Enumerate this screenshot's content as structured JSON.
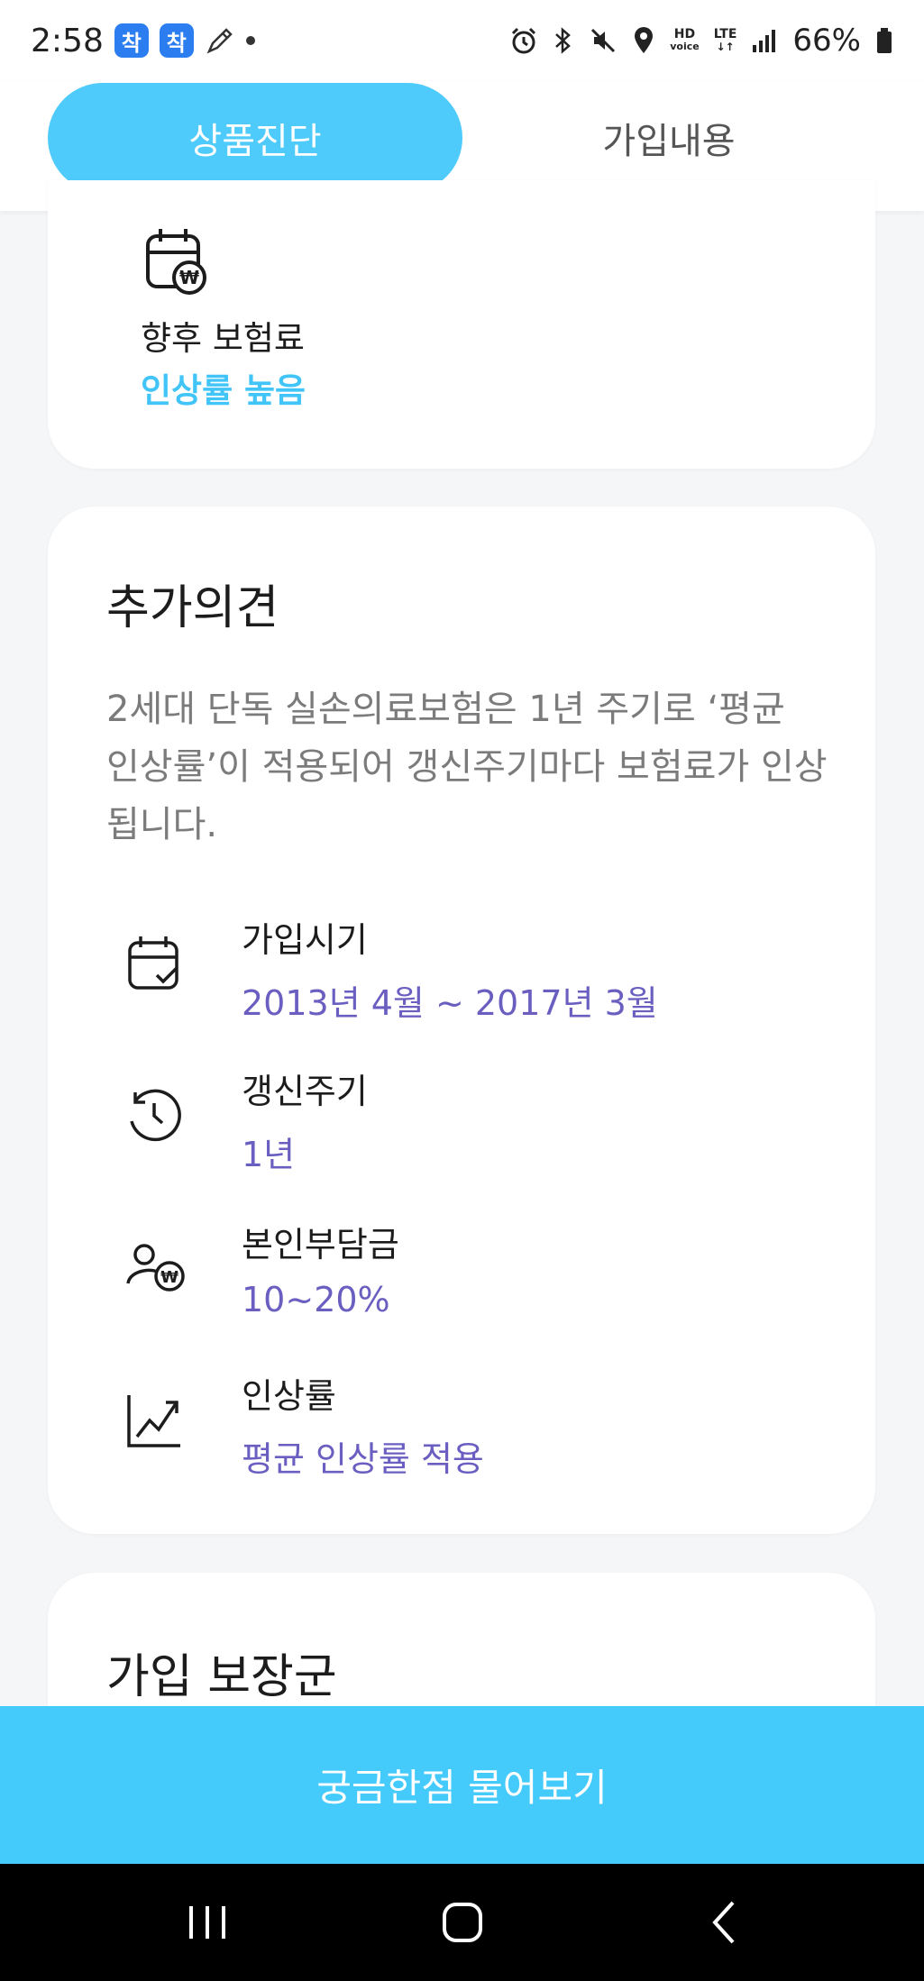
{
  "status_bar": {
    "time": "2:58",
    "app_badge_1": "착",
    "app_badge_2": "착",
    "hd_top": "HD",
    "hd_bottom": "voice",
    "lte": "LTE",
    "battery": "66%"
  },
  "tabs": [
    {
      "label": "상품진단",
      "active": true
    },
    {
      "label": "가입내용",
      "active": false
    }
  ],
  "premium": {
    "icon": "calendar-won-icon",
    "label": "향후 보험료",
    "value": "인상률 높음"
  },
  "opinion": {
    "title": "추가의견",
    "description": "2세대 단독 실손의료보험은 1년 주기로 ‘평균 인상률’이 적용되어 갱신주기마다 보험료가 인상됩니다.",
    "items": [
      {
        "icon": "calendar-check-icon",
        "label": "가입시기",
        "value": "2013년 4월 ~ 2017년 3월"
      },
      {
        "icon": "renewal-clock-icon",
        "label": "갱신주기",
        "value": "1년"
      },
      {
        "icon": "person-won-icon",
        "label": "본인부담금",
        "value": "10~20%"
      },
      {
        "icon": "trend-chart-icon",
        "label": "인상률",
        "value": "평균 인상률 적용"
      }
    ]
  },
  "coverage": {
    "title": "가입 보장군"
  },
  "cta_label": "궁금한점 물어보기",
  "colors": {
    "accent": "#4fcbfb",
    "value_purple": "#6a5fc1",
    "highlight_blue": "#41c4f7"
  }
}
